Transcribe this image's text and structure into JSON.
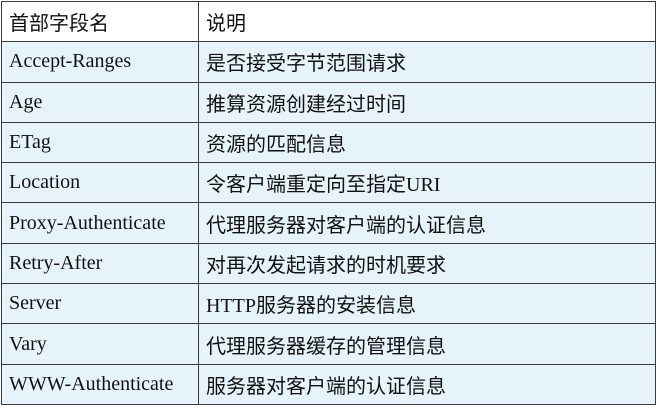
{
  "table": {
    "headers": [
      "首部字段名",
      "说明"
    ],
    "rows": [
      [
        "Accept-Ranges",
        "是否接受字节范围请求"
      ],
      [
        "Age",
        "推算资源创建经过时间"
      ],
      [
        "ETag",
        "资源的匹配信息"
      ],
      [
        "Location",
        "令客户端重定向至指定URI"
      ],
      [
        "Proxy-Authenticate",
        "代理服务器对客户端的认证信息"
      ],
      [
        "Retry-After",
        "对再次发起请求的时机要求"
      ],
      [
        "Server",
        "HTTP服务器的安装信息"
      ],
      [
        "Vary",
        "代理服务器缓存的管理信息"
      ],
      [
        "WWW-Authenticate",
        "服务器对客户端的认证信息"
      ]
    ]
  },
  "colors": {
    "header_background": "#ffffff",
    "row_background": "#e7f3fb",
    "border": "#3a3a3a",
    "text": "#111111"
  }
}
